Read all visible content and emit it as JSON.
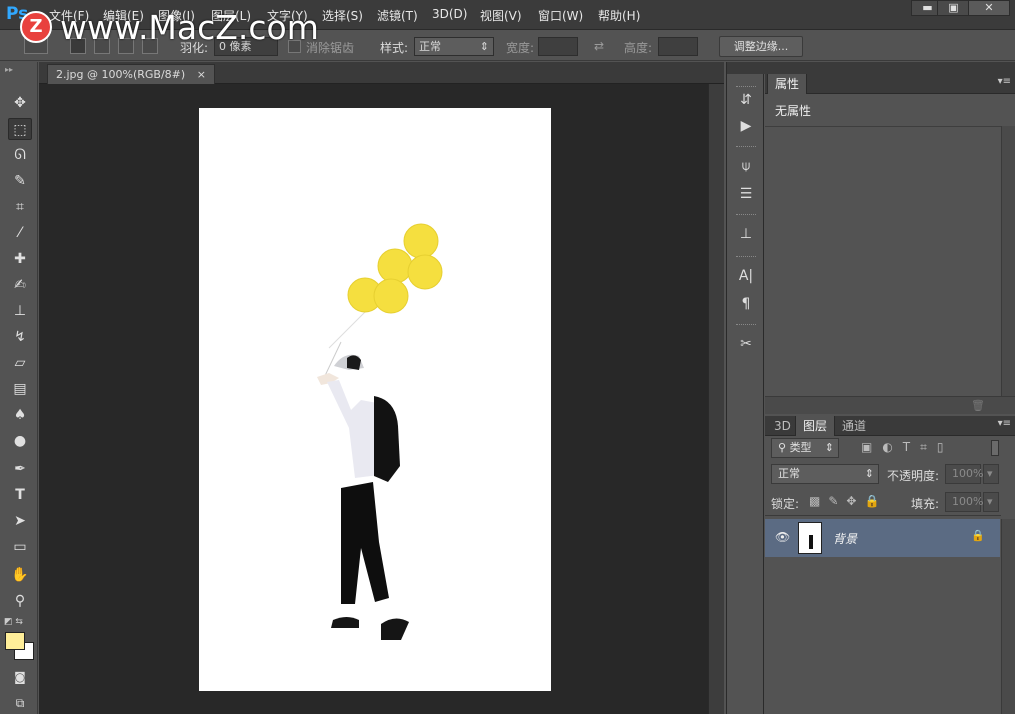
{
  "app": {
    "logo": "Ps"
  },
  "watermark": {
    "badge": "Z",
    "text": "www.MacZ.com"
  },
  "menu": {
    "items": [
      "文件(F)",
      "编辑(E)",
      "图像(I)",
      "图层(L)",
      "文字(Y)",
      "选择(S)",
      "滤镜(T)",
      "3D(D)",
      "视图(V)",
      "窗口(W)",
      "帮助(H)"
    ]
  },
  "window_controls": {
    "minimize": "▬",
    "restore": "▣",
    "close": "✕"
  },
  "options": {
    "feather_label": "羽化:",
    "feather_value": "0 像素",
    "antialias_label": "消除锯齿",
    "style_label": "样式:",
    "style_value": "正常",
    "width_label": "宽度:",
    "height_label": "高度:",
    "refine_edge": "调整边缘..."
  },
  "document": {
    "tab_title": "2.jpg @ 100%(RGB/8#)",
    "tab_close": "×"
  },
  "properties_panel": {
    "tab": "属性",
    "content": "无属性"
  },
  "layers_panel": {
    "tabs": [
      "3D",
      "图层",
      "通道"
    ],
    "filter_kind": "类型",
    "blend_mode": "正常",
    "opacity_label": "不透明度:",
    "opacity_value": "100%",
    "lock_label": "锁定:",
    "fill_label": "填充:",
    "fill_value": "100%",
    "layers": [
      {
        "name": "背景",
        "locked": true,
        "visible": true
      }
    ]
  },
  "colors": {
    "foreground": "#ffee99",
    "background": "#ffffff",
    "balloon": "#f5df3f",
    "selected_layer": "#5b6b83"
  },
  "icons": {
    "tools": [
      "move-icon",
      "marquee-icon",
      "lasso-icon",
      "quick-select-icon",
      "crop-icon",
      "eyedropper-icon",
      "healing-icon",
      "brush-icon",
      "stamp-icon",
      "history-brush-icon",
      "eraser-icon",
      "gradient-icon",
      "blur-icon",
      "dodge-icon",
      "pen-icon",
      "type-icon",
      "path-select-icon",
      "shape-icon",
      "hand-icon",
      "zoom-icon"
    ]
  }
}
